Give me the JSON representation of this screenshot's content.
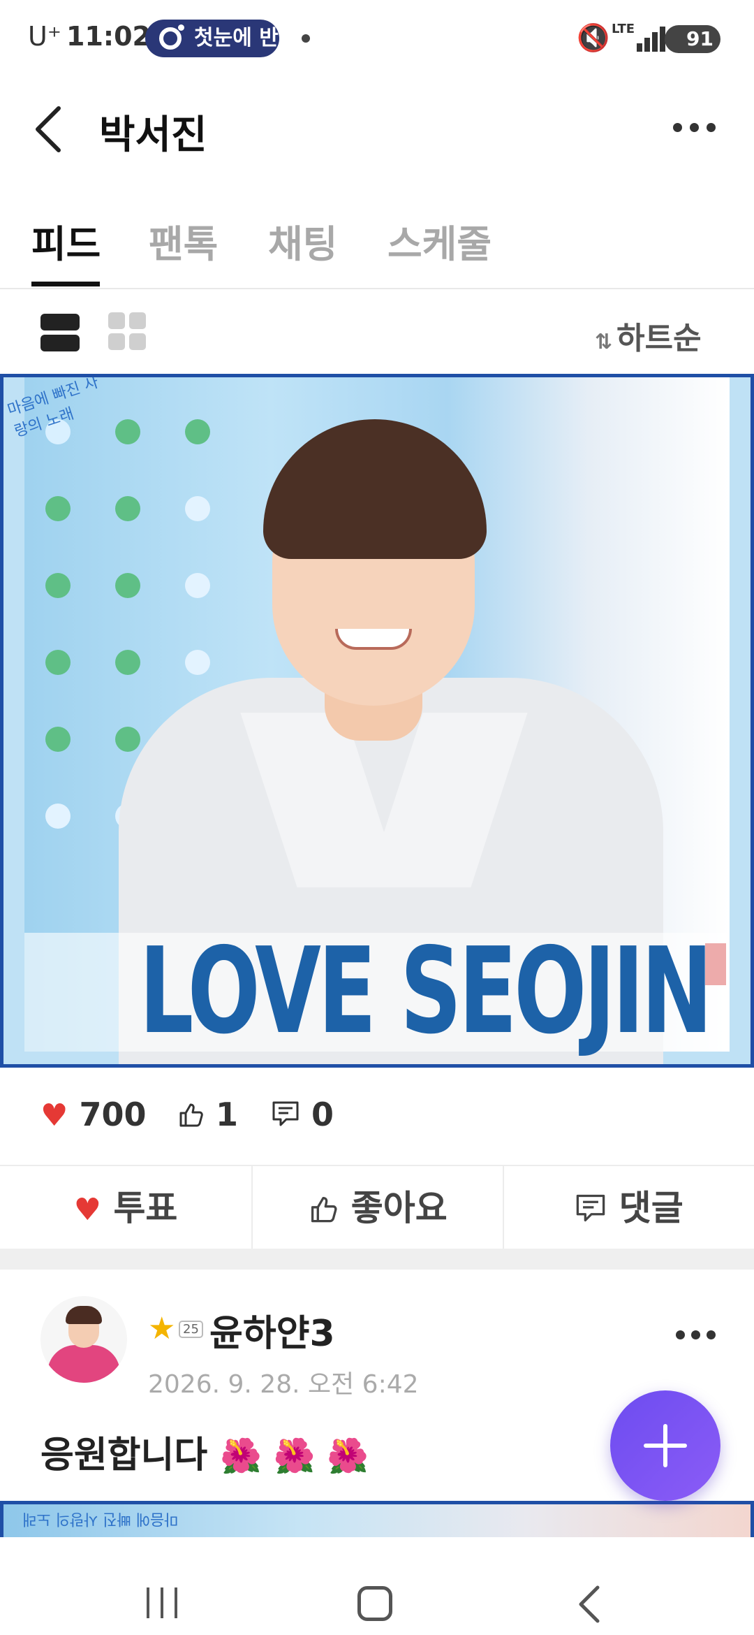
{
  "status_bar": {
    "carrier": "U⁺",
    "time": "11:02",
    "pill_text": "첫눈에 반",
    "network": "LTE",
    "battery": "91"
  },
  "header": {
    "title": "박서진"
  },
  "tabs": [
    {
      "label": "피드",
      "active": true
    },
    {
      "label": "팬톡",
      "active": false
    },
    {
      "label": "채팅",
      "active": false
    },
    {
      "label": "스케줄",
      "active": false
    }
  ],
  "view_bar": {
    "sort_label": "하트순"
  },
  "feed_item": {
    "image_text": "LOVE SEOJIN",
    "stamp_text": "마음에 빠진 사랑의 노래",
    "stats": {
      "hearts": "700",
      "likes": "1",
      "comments": "0"
    },
    "actions": {
      "vote": "투표",
      "like": "좋아요",
      "comment": "댓글"
    }
  },
  "post": {
    "badge_level": "25",
    "username": "윤하얀3",
    "timestamp": "2026. 9. 28. 오전 6:42",
    "text": "응원합니다",
    "emojis": "🌺 🌺 🌺"
  },
  "colors": {
    "accent_purple": "#7b56f3",
    "frame_blue": "#1f4fa6",
    "heart_red": "#e53935",
    "pill_navy": "#2a3777"
  }
}
